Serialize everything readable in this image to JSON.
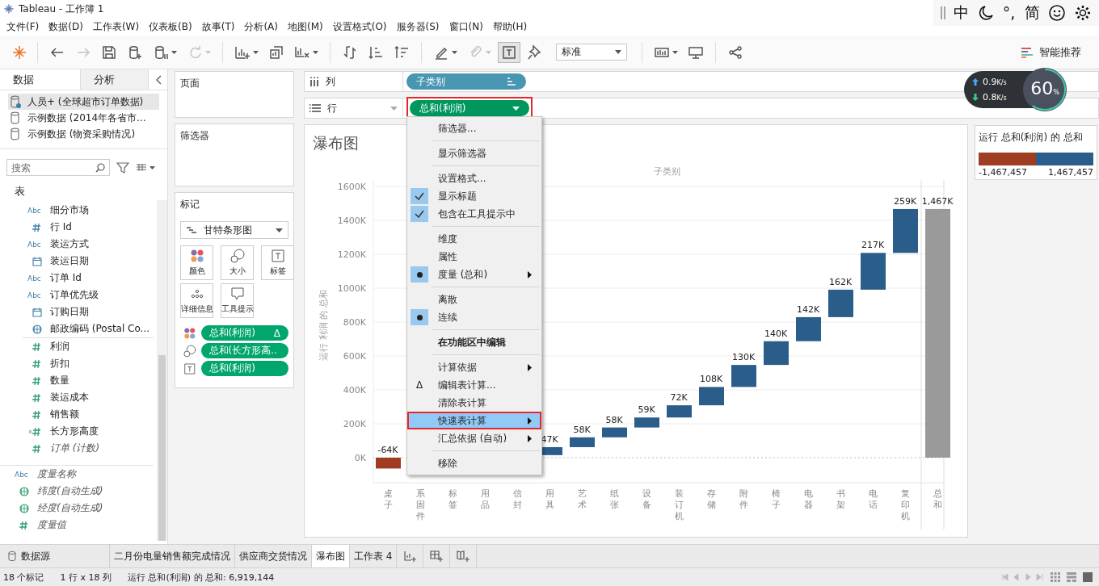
{
  "window": {
    "title": "Tableau - 工作簿 1"
  },
  "ime_bar": {
    "items": [
      {
        "kind": "text",
        "label": "中"
      },
      {
        "kind": "moon"
      },
      {
        "kind": "text",
        "label": "°,"
      },
      {
        "kind": "text",
        "label": "简"
      },
      {
        "kind": "smiley"
      },
      {
        "kind": "gear"
      }
    ]
  },
  "menu_bar": [
    "文件(F)",
    "数据(D)",
    "工作表(W)",
    "仪表板(B)",
    "故事(T)",
    "分析(A)",
    "地图(M)",
    "设置格式(O)",
    "服务器(S)",
    "窗口(N)",
    "帮助(H)"
  ],
  "toolbar": {
    "buttons": [
      {
        "kind": "logo"
      },
      {
        "kind": "separator"
      },
      {
        "kind": "back",
        "disabled": false,
        "pressed": false,
        "caret": false
      },
      {
        "kind": "forward",
        "disabled": true,
        "pressed": false,
        "caret": false
      },
      {
        "kind": "save",
        "disabled": false,
        "pressed": false,
        "caret": false
      },
      {
        "kind": "add-data",
        "disabled": false,
        "pressed": false,
        "caret": false
      },
      {
        "kind": "pause",
        "disabled": false,
        "pressed": false,
        "caret": true
      },
      {
        "kind": "refresh",
        "disabled": true,
        "pressed": false,
        "caret": true
      },
      {
        "kind": "separator"
      },
      {
        "kind": "new-sheet",
        "disabled": false,
        "pressed": false,
        "caret": true
      },
      {
        "kind": "duplicate",
        "disabled": false,
        "pressed": false,
        "caret": false
      },
      {
        "kind": "clear",
        "disabled": false,
        "pressed": false,
        "caret": true
      },
      {
        "kind": "separator"
      },
      {
        "kind": "swap",
        "disabled": false,
        "pressed": false,
        "caret": false
      },
      {
        "kind": "sort-asc",
        "disabled": false,
        "pressed": false,
        "caret": false
      },
      {
        "kind": "sort-desc",
        "disabled": false,
        "pressed": false,
        "caret": false
      },
      {
        "kind": "separator"
      },
      {
        "kind": "highlight",
        "disabled": false,
        "pressed": false,
        "caret": true
      },
      {
        "kind": "annotate",
        "disabled": true,
        "pressed": false,
        "caret": true
      },
      {
        "kind": "labels",
        "disabled": false,
        "pressed": true,
        "caret": false
      },
      {
        "kind": "pin",
        "disabled": false,
        "pressed": false,
        "caret": false
      },
      {
        "kind": "fit"
      },
      {
        "kind": "separator"
      },
      {
        "kind": "show-me",
        "disabled": false,
        "pressed": false,
        "caret": true
      },
      {
        "kind": "presentation",
        "disabled": false,
        "pressed": false,
        "caret": false
      },
      {
        "kind": "separator"
      },
      {
        "kind": "share",
        "disabled": false,
        "pressed": false,
        "caret": false
      }
    ],
    "fit_dropdown": {
      "value": "标准"
    },
    "show_me": {
      "label": "智能推荐"
    }
  },
  "net_widget": {
    "upload": "0.9",
    "upload_unit": "K/s",
    "download": "0.8",
    "download_unit": "K/s",
    "percent": "60",
    "percent_unit": "%"
  },
  "data_pane": {
    "tabs": [
      {
        "label": "数据",
        "selected": true
      },
      {
        "label": "分析",
        "selected": false
      }
    ],
    "data_sources": [
      {
        "label": "人员+ (全球超市订单数据)",
        "selected": true,
        "primary": true
      },
      {
        "label": "示例数据 (2014年各省市...",
        "selected": false,
        "primary": false
      },
      {
        "label": "示例数据 (物资采购情况)",
        "selected": false,
        "primary": false
      }
    ],
    "search": {
      "placeholder": "搜索"
    },
    "tables": [
      {
        "label": "表",
        "groups": [
          {
            "fields": [
              {
                "kind": "text",
                "badge": "Abc",
                "label": "细分市场",
                "measure": false,
                "italic": false
              },
              {
                "kind": "number",
                "label": "行 Id",
                "measure": false,
                "italic": false
              },
              {
                "kind": "text",
                "badge": "Abc",
                "label": "装运方式",
                "measure": false,
                "italic": false
              },
              {
                "kind": "date",
                "label": "装运日期",
                "measure": false,
                "italic": false
              },
              {
                "kind": "text",
                "badge": "Abc",
                "label": "订单 Id",
                "measure": false,
                "italic": false
              },
              {
                "kind": "text",
                "badge": "Abc",
                "label": "订单优先级",
                "measure": false,
                "italic": false
              },
              {
                "kind": "date",
                "label": "订购日期",
                "measure": false,
                "italic": false
              },
              {
                "kind": "geo",
                "label": "邮政编码 (Postal Co...",
                "measure": false,
                "italic": false
              }
            ]
          },
          {
            "fields": [
              {
                "kind": "number",
                "label": "利润",
                "measure": true,
                "italic": false
              },
              {
                "kind": "number",
                "label": "折扣",
                "measure": true,
                "italic": false
              },
              {
                "kind": "number",
                "label": "数量",
                "measure": true,
                "italic": false
              },
              {
                "kind": "number",
                "label": "装运成本",
                "measure": true,
                "italic": false
              },
              {
                "kind": "number",
                "label": "销售额",
                "measure": true,
                "italic": false
              },
              {
                "kind": "calc",
                "label": "长方形高度",
                "measure": true,
                "italic": false
              },
              {
                "kind": "number",
                "label": "订单 (计数)",
                "measure": true,
                "italic": true
              }
            ]
          }
        ]
      }
    ],
    "extra_fields": [
      {
        "kind": "text",
        "badge": "Abc",
        "label": "度量名称",
        "measure": false,
        "italic": true
      },
      {
        "kind": "geo",
        "label": "纬度(自动生成)",
        "measure": true,
        "italic": true
      },
      {
        "kind": "geo",
        "label": "经度(自动生成)",
        "measure": true,
        "italic": true
      },
      {
        "kind": "number",
        "label": "度量值",
        "measure": true,
        "italic": true
      }
    ]
  },
  "pages_card": {
    "title": "页面"
  },
  "filters_card": {
    "title": "筛选器"
  },
  "marks_card": {
    "title": "标记",
    "mark_type": "甘特条形图",
    "buttons": [
      {
        "kind": "color",
        "label": "颜色"
      },
      {
        "kind": "size",
        "label": "大小"
      },
      {
        "kind": "label",
        "label": "标签"
      },
      {
        "kind": "detail",
        "label": "详细信息"
      },
      {
        "kind": "tooltip",
        "label": "工具提示"
      }
    ],
    "pills": [
      {
        "kind": "color",
        "label": "总和(利润)",
        "calc_mark": "Δ"
      },
      {
        "kind": "size",
        "label": "总和(长方形高.."
      },
      {
        "kind": "label",
        "label": "总和(利润)"
      }
    ]
  },
  "columns_shelf": {
    "label": "列",
    "pills": [
      {
        "label": "子类别",
        "sorted": true
      }
    ]
  },
  "rows_shelf": {
    "label": "行",
    "pills": [
      {
        "label": "总和(利润)",
        "annotated": true
      }
    ]
  },
  "view": {
    "title": "瀑布图",
    "chart": {
      "xlabel": "子类别",
      "ylabel": "运行 利润 的 总和",
      "y_ticks": [
        "1600K",
        "1400K",
        "1200K",
        "1000K",
        "800K",
        "600K",
        "400K",
        "200K",
        "0K"
      ],
      "bars": [
        {
          "category": "桌子",
          "label": "-64K"
        },
        {
          "category": "系固件"
        },
        {
          "category": "标签"
        },
        {
          "category": "用品"
        },
        {
          "category": "信封"
        },
        {
          "category": "用具",
          "label": "47K"
        },
        {
          "category": "艺术",
          "label": "58K"
        },
        {
          "category": "纸张",
          "label": "58K"
        },
        {
          "category": "设备",
          "label": "59K"
        },
        {
          "category": "装订机",
          "label": "72K"
        },
        {
          "category": "存储",
          "label": "108K"
        },
        {
          "category": "附件",
          "label": "130K"
        },
        {
          "category": "椅子",
          "label": "140K"
        },
        {
          "category": "电器",
          "label": "142K"
        },
        {
          "category": "书架",
          "label": "162K"
        },
        {
          "category": "电话",
          "label": "217K"
        },
        {
          "category": "复印机",
          "label": "259K"
        },
        {
          "category": "总和",
          "label": "1,467K"
        }
      ]
    },
    "legend": {
      "title": "运行 总和(利润) 的 总和",
      "swatches": [
        {
          "color": "#9e3d22"
        },
        {
          "color": "#2b5d8b"
        }
      ],
      "min": "-1,467,457",
      "max": "1,467,457"
    }
  },
  "context_menu": {
    "items": [
      {
        "kind": "action",
        "label": "筛选器...",
        "submenu": false,
        "selected": false,
        "bold": false,
        "annotated": false
      },
      {
        "kind": "separator"
      },
      {
        "kind": "action",
        "label": "显示筛选器",
        "submenu": false,
        "selected": false,
        "bold": false,
        "annotated": false
      },
      {
        "kind": "separator"
      },
      {
        "kind": "action",
        "label": "设置格式...",
        "submenu": false,
        "selected": false,
        "bold": false,
        "annotated": false
      },
      {
        "kind": "check",
        "label": "显示标题",
        "checked": true,
        "submenu": false,
        "selected": false,
        "bold": false,
        "annotated": false
      },
      {
        "kind": "check",
        "label": "包含在工具提示中",
        "checked": true,
        "submenu": false,
        "selected": false,
        "bold": false,
        "annotated": false
      },
      {
        "kind": "separator"
      },
      {
        "kind": "radio",
        "label": "维度",
        "checked": false,
        "submenu": false,
        "selected": false,
        "bold": false,
        "annotated": false
      },
      {
        "kind": "radio",
        "label": "属性",
        "checked": false,
        "submenu": false,
        "selected": false,
        "bold": false,
        "annotated": false
      },
      {
        "kind": "radio",
        "label": "度量 (总和)",
        "checked": true,
        "submenu": true,
        "selected": false,
        "bold": false,
        "annotated": false
      },
      {
        "kind": "separator"
      },
      {
        "kind": "radio",
        "label": "离散",
        "checked": false,
        "submenu": false,
        "selected": false,
        "bold": false,
        "annotated": false
      },
      {
        "kind": "radio",
        "label": "连续",
        "checked": true,
        "submenu": false,
        "selected": false,
        "bold": false,
        "annotated": false
      },
      {
        "kind": "separator"
      },
      {
        "kind": "action",
        "label": "在功能区中编辑",
        "submenu": false,
        "selected": false,
        "bold": true,
        "annotated": false
      },
      {
        "kind": "separator"
      },
      {
        "kind": "action",
        "label": "计算依据",
        "submenu": true,
        "selected": false,
        "bold": false,
        "annotated": false
      },
      {
        "kind": "action",
        "label": "编辑表计算...",
        "glyph": "Δ",
        "submenu": false,
        "selected": false,
        "bold": false,
        "annotated": false
      },
      {
        "kind": "action",
        "label": "清除表计算",
        "submenu": false,
        "selected": false,
        "bold": false,
        "annotated": false
      },
      {
        "kind": "action",
        "label": "快速表计算",
        "submenu": true,
        "selected": true,
        "bold": false,
        "annotated": true
      },
      {
        "kind": "action",
        "label": "汇总依据 (自动)",
        "submenu": true,
        "selected": false,
        "bold": false,
        "annotated": false
      },
      {
        "kind": "separator"
      },
      {
        "kind": "action",
        "label": "移除",
        "submenu": false,
        "selected": false,
        "bold": false,
        "annotated": false
      }
    ]
  },
  "sheet_tabs": {
    "data_source": "数据源",
    "sheets": [
      {
        "label": "二月份电量销售额完成情况",
        "selected": false
      },
      {
        "label": "供应商交货情况",
        "selected": false
      },
      {
        "label": "瀑布图",
        "selected": true
      },
      {
        "label": "工作表 4",
        "selected": false
      }
    ]
  },
  "status_bar": {
    "marks": "18 个标记",
    "dims": "1 行 x 18 列",
    "summary": "运行 总和(利润) 的 总和: 6,919,144"
  }
}
